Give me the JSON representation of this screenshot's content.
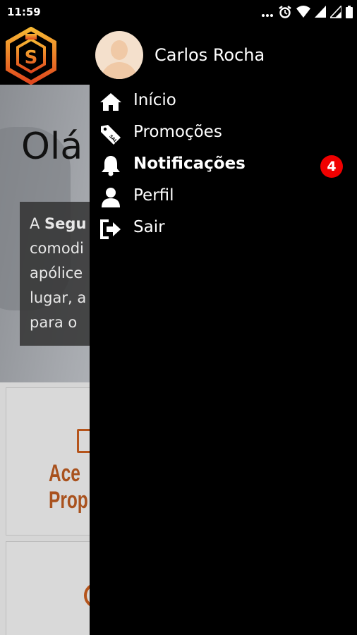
{
  "status_bar": {
    "time": "11:59",
    "icons": [
      "more-icon",
      "alarm-icon",
      "wifi-icon",
      "signal-icon",
      "signal-icon",
      "battery-icon"
    ]
  },
  "background_app": {
    "hero_title": "Olá",
    "hero_text_lines": [
      {
        "prefix": "A ",
        "bold": "Segu",
        "rest": ""
      },
      {
        "prefix": "comodi",
        "bold": "",
        "rest": ""
      },
      {
        "prefix": "apólice",
        "bold": "",
        "rest": ""
      },
      {
        "prefix": "lugar, a",
        "bold": "",
        "rest": ""
      },
      {
        "prefix": "para o",
        "bold": "",
        "rest": ""
      }
    ],
    "cards": [
      {
        "label_line1": "Ace",
        "label_line2": "Prop",
        "icon": "document-icon"
      },
      {
        "label_line1": "",
        "label_line2": "",
        "icon": "circle-icon"
      }
    ],
    "accent_color": "#b5541b"
  },
  "drawer": {
    "user_name": "Carlos Rocha",
    "menu_items": [
      {
        "label": "Início",
        "icon": "home-icon",
        "bold": false
      },
      {
        "label": "Promoções",
        "icon": "sale-tag-icon",
        "bold": false
      },
      {
        "label": "Notificações",
        "icon": "bell-icon",
        "bold": true,
        "badge": "4"
      },
      {
        "label": "Perfil",
        "icon": "user-icon",
        "bold": false
      },
      {
        "label": "Sair",
        "icon": "logout-icon",
        "bold": false
      }
    ],
    "badge_color": "#f00000"
  }
}
